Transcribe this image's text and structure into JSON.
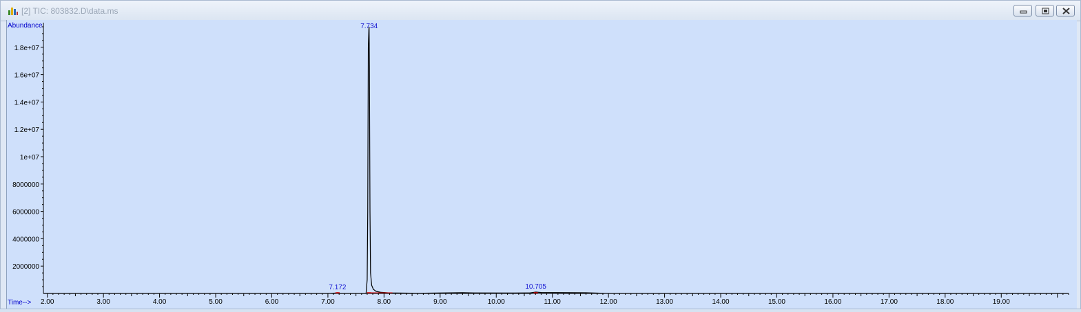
{
  "window": {
    "title": "[2] TIC: 803832.D\\data.ms",
    "buttons": [
      "minimize",
      "restore",
      "close"
    ]
  },
  "colors": {
    "plot_background": "#cfe0fb",
    "axis_label": "#0000cc",
    "trace": "#000000",
    "peak_label": "#1010d0",
    "baseline_marker": "#d00000"
  },
  "chart_data": {
    "type": "line",
    "ylabel": "Abundance",
    "xlabel": "Time-->",
    "xlim": [
      1.93,
      20.2
    ],
    "ylim": [
      0,
      19800000
    ],
    "x_ticks": [
      "2.00",
      "3.00",
      "4.00",
      "5.00",
      "6.00",
      "7.00",
      "8.00",
      "9.00",
      "10.00",
      "11.00",
      "12.00",
      "13.00",
      "14.00",
      "15.00",
      "16.00",
      "17.00",
      "18.00",
      "19.00"
    ],
    "y_ticks": [
      "2000000",
      "4000000",
      "6000000",
      "8000000",
      "1e+07",
      "1.2e+07",
      "1.4e+07",
      "1.6e+07",
      "1.8e+07"
    ],
    "peak_labels": [
      {
        "time": 7.172,
        "label": "7.172"
      },
      {
        "time": 7.734,
        "label": "7.734"
      },
      {
        "time": 10.705,
        "label": "10.705"
      }
    ],
    "series": [
      {
        "x": [
          1.93,
          7.0,
          7.16,
          7.172,
          7.19,
          7.68,
          7.7,
          7.71,
          7.72,
          7.73,
          7.734,
          7.74,
          7.75,
          7.76,
          7.78,
          7.81,
          7.86,
          7.95,
          8.1,
          8.6,
          9.4,
          9.6,
          10.3,
          10.6,
          10.705,
          10.8,
          11.6,
          12.0,
          20.2
        ],
        "y": [
          0,
          0,
          30000,
          60000,
          0,
          0,
          1000000,
          6000000,
          18000000,
          19300000,
          19500000,
          16500000,
          6000000,
          1500000,
          600000,
          300000,
          150000,
          80000,
          40000,
          15000,
          60000,
          40000,
          30000,
          40000,
          100000,
          70000,
          50000,
          0,
          0
        ]
      }
    ]
  }
}
